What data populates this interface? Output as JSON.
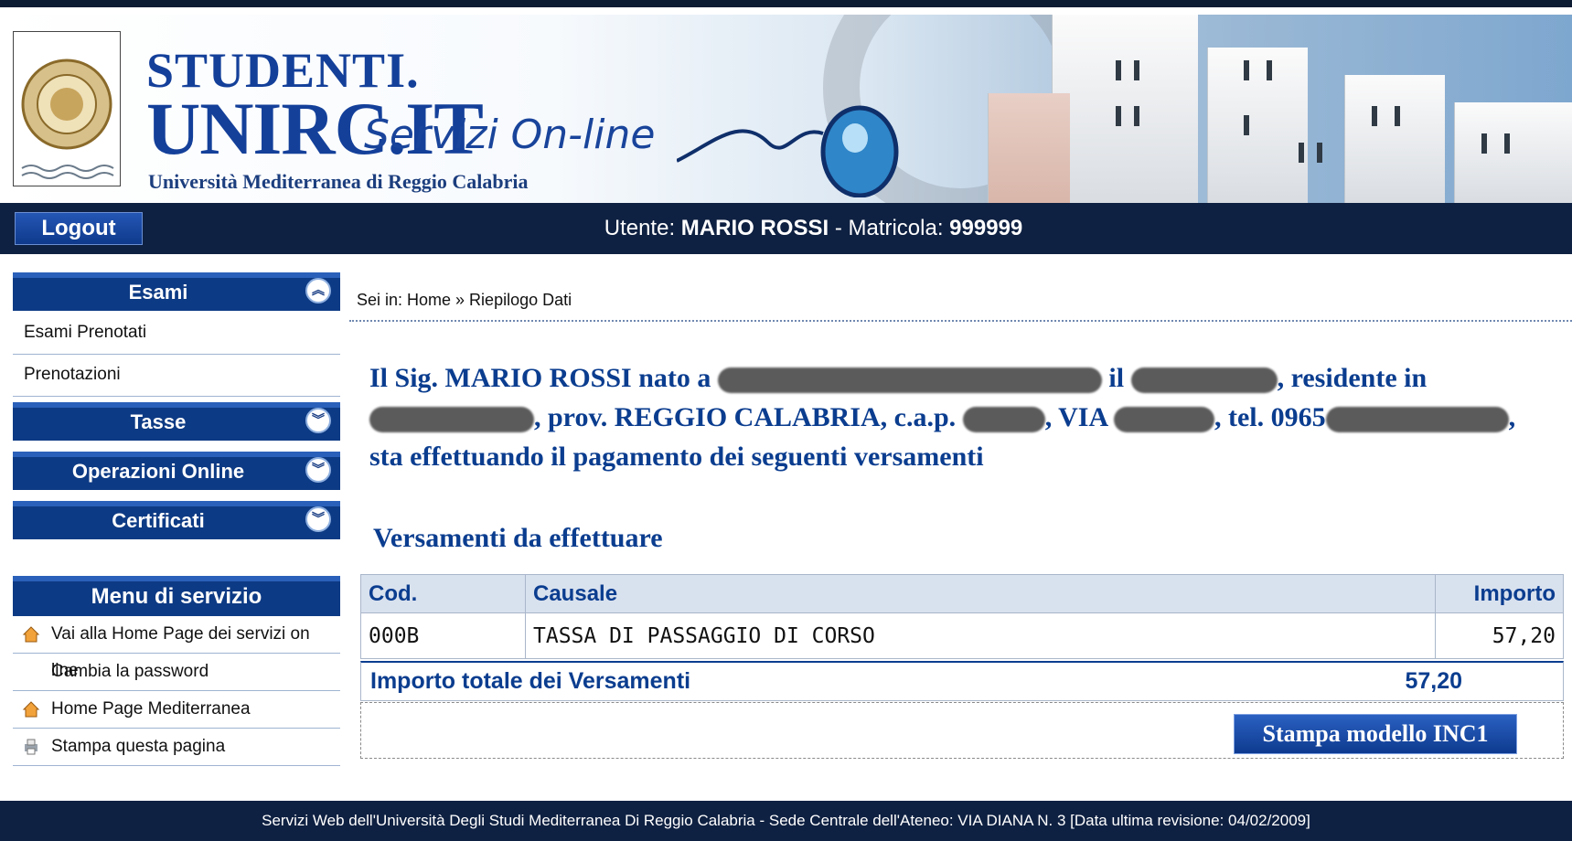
{
  "header": {
    "brand_line1": "STUDENTI.",
    "brand_line2": "UNIRC.IT",
    "brand_line3": "Servizi On-line",
    "subtitle": "Università Mediterranea di Reggio Calabria"
  },
  "topbar": {
    "logout_label": "Logout",
    "user_prefix": "Utente:",
    "user_name": "MARIO ROSSI",
    "separator": "- Matricola:",
    "matricola": "999999"
  },
  "sidebar": {
    "sections": [
      {
        "label": "Esami",
        "expanded": true,
        "items": [
          "Esami Prenotati",
          "Prenotazioni"
        ]
      },
      {
        "label": "Tasse",
        "expanded": false
      },
      {
        "label": "Operazioni Online",
        "expanded": false
      },
      {
        "label": "Certificati",
        "expanded": false
      }
    ],
    "service_menu": {
      "title": "Menu di servizio",
      "items": [
        {
          "label": "Vai alla Home Page dei servizi on line",
          "icon": "home-icon"
        },
        {
          "label": "Cambia la password",
          "icon": ""
        },
        {
          "label": "Home Page Mediterranea",
          "icon": "home-icon"
        },
        {
          "label": "Stampa questa pagina",
          "icon": "printer-icon"
        }
      ]
    }
  },
  "breadcrumb": {
    "text": "Sei in: Home » Riepilogo Dati"
  },
  "intro": {
    "p1": "Il Sig. MARIO ROSSI  nato a",
    "p2": "il",
    "p3": ", residente in",
    "p4": ", prov. REGGIO CALABRIA, c.a.p.",
    "p5": ", VIA",
    "p6": ", tel. 0965",
    "p7": ",",
    "p8": "sta effettuando il pagamento dei seguenti versamenti"
  },
  "payments": {
    "title": "Versamenti da effettuare",
    "columns": [
      "Cod.",
      "Causale",
      "Importo"
    ],
    "rows": [
      {
        "cod": "000B",
        "causale": "TASSA DI PASSAGGIO DI CORSO",
        "importo": "57,20"
      }
    ],
    "total_label": "Importo totale dei Versamenti",
    "total_value": "57,20",
    "print_button": "Stampa modello INC1"
  },
  "footer": {
    "text": "Servizi Web dell'Università Degli Studi Mediterranea Di Reggio Calabria - Sede Centrale dell'Ateneo: VIA DIANA N. 3 [Data ultima revisione: 04/02/2009]"
  },
  "colors": {
    "navy": "#0f2142",
    "brand_blue": "#14409a",
    "text_blue": "#0b3d8f"
  }
}
